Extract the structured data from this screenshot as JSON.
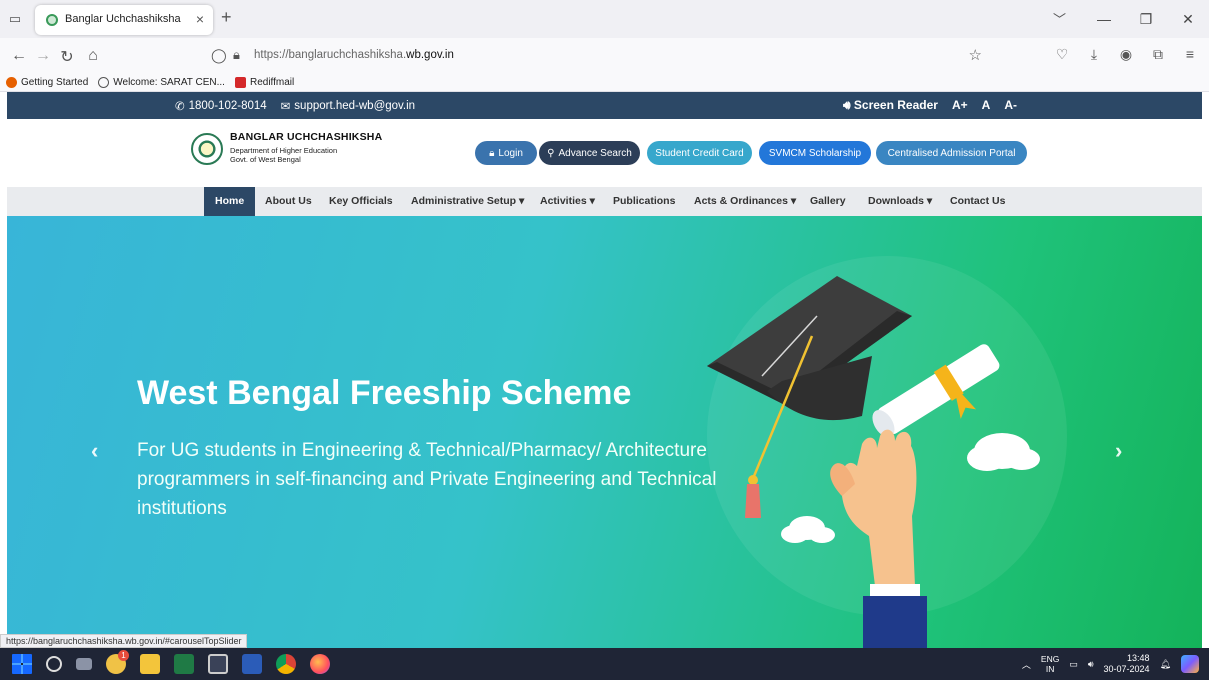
{
  "browser": {
    "tab_title": "Banglar Uchchashiksha",
    "tab_close": "×",
    "new_tab": "+",
    "url_prefix": "https://banglaruchchashiksha.",
    "url_domain": "wb.gov.in",
    "bookmarks": [
      {
        "label": "Getting Started",
        "icon": "firefox-icon",
        "color": "#e66000"
      },
      {
        "label": "Welcome: SARAT CEN...",
        "icon": "globe-icon",
        "color": "#555555"
      },
      {
        "label": "Rediffmail",
        "icon": "rediff-icon",
        "color": "#d4282a"
      }
    ],
    "status_url": "https://banglaruchchashiksha.wb.gov.in/#carouselTopSlider"
  },
  "topbar": {
    "phone": "1800-102-8014",
    "email": "support.hed-wb@gov.in",
    "screen_reader": "Screen Reader",
    "font_larger": "A+",
    "font_normal": "A",
    "font_smaller": "A-"
  },
  "header": {
    "brand_name": "BANGLAR UCHCHASHIKSHA",
    "dept_line1": "Department of Higher Education",
    "dept_line2": "Govt. of West Bengal",
    "buttons": [
      {
        "label": "Login",
        "icon": "lock-icon",
        "color": "#3a73ad"
      },
      {
        "label": "Advance Search",
        "icon": "search-icon",
        "color": "#2c3e58"
      },
      {
        "label": "Student Credit Card",
        "icon": "",
        "color": "#37a7cc"
      },
      {
        "label": "SVMCM Scholarship",
        "icon": "",
        "color": "#2377d9"
      },
      {
        "label": "Centralised Admission Portal",
        "icon": "",
        "color": "#3a86c2"
      }
    ]
  },
  "menu": [
    {
      "label": "Home"
    },
    {
      "label": "About Us"
    },
    {
      "label": "Key Officials"
    },
    {
      "label": "Administrative Setup ▾"
    },
    {
      "label": "Activities ▾"
    },
    {
      "label": "Publications"
    },
    {
      "label": "Acts & Ordinances ▾"
    },
    {
      "label": "Gallery"
    },
    {
      "label": "Downloads ▾"
    },
    {
      "label": "Contact Us"
    }
  ],
  "hero": {
    "title": "West Bengal Freeship Scheme",
    "subtitle": "For UG students in Engineering & Technical/Pharmacy/ Architecture programmers in self-financing and Private Engineering and Technical institutions",
    "prev": "‹",
    "next": "›"
  },
  "taskbar": {
    "lang_top": "ENG",
    "lang_bottom": "IN",
    "time": "13:48",
    "date": "30-07-2024",
    "notification_count": "1"
  },
  "colors": {
    "navy": "#2c4866",
    "hero_start": "#38b5d8",
    "hero_end": "#14b35a"
  }
}
